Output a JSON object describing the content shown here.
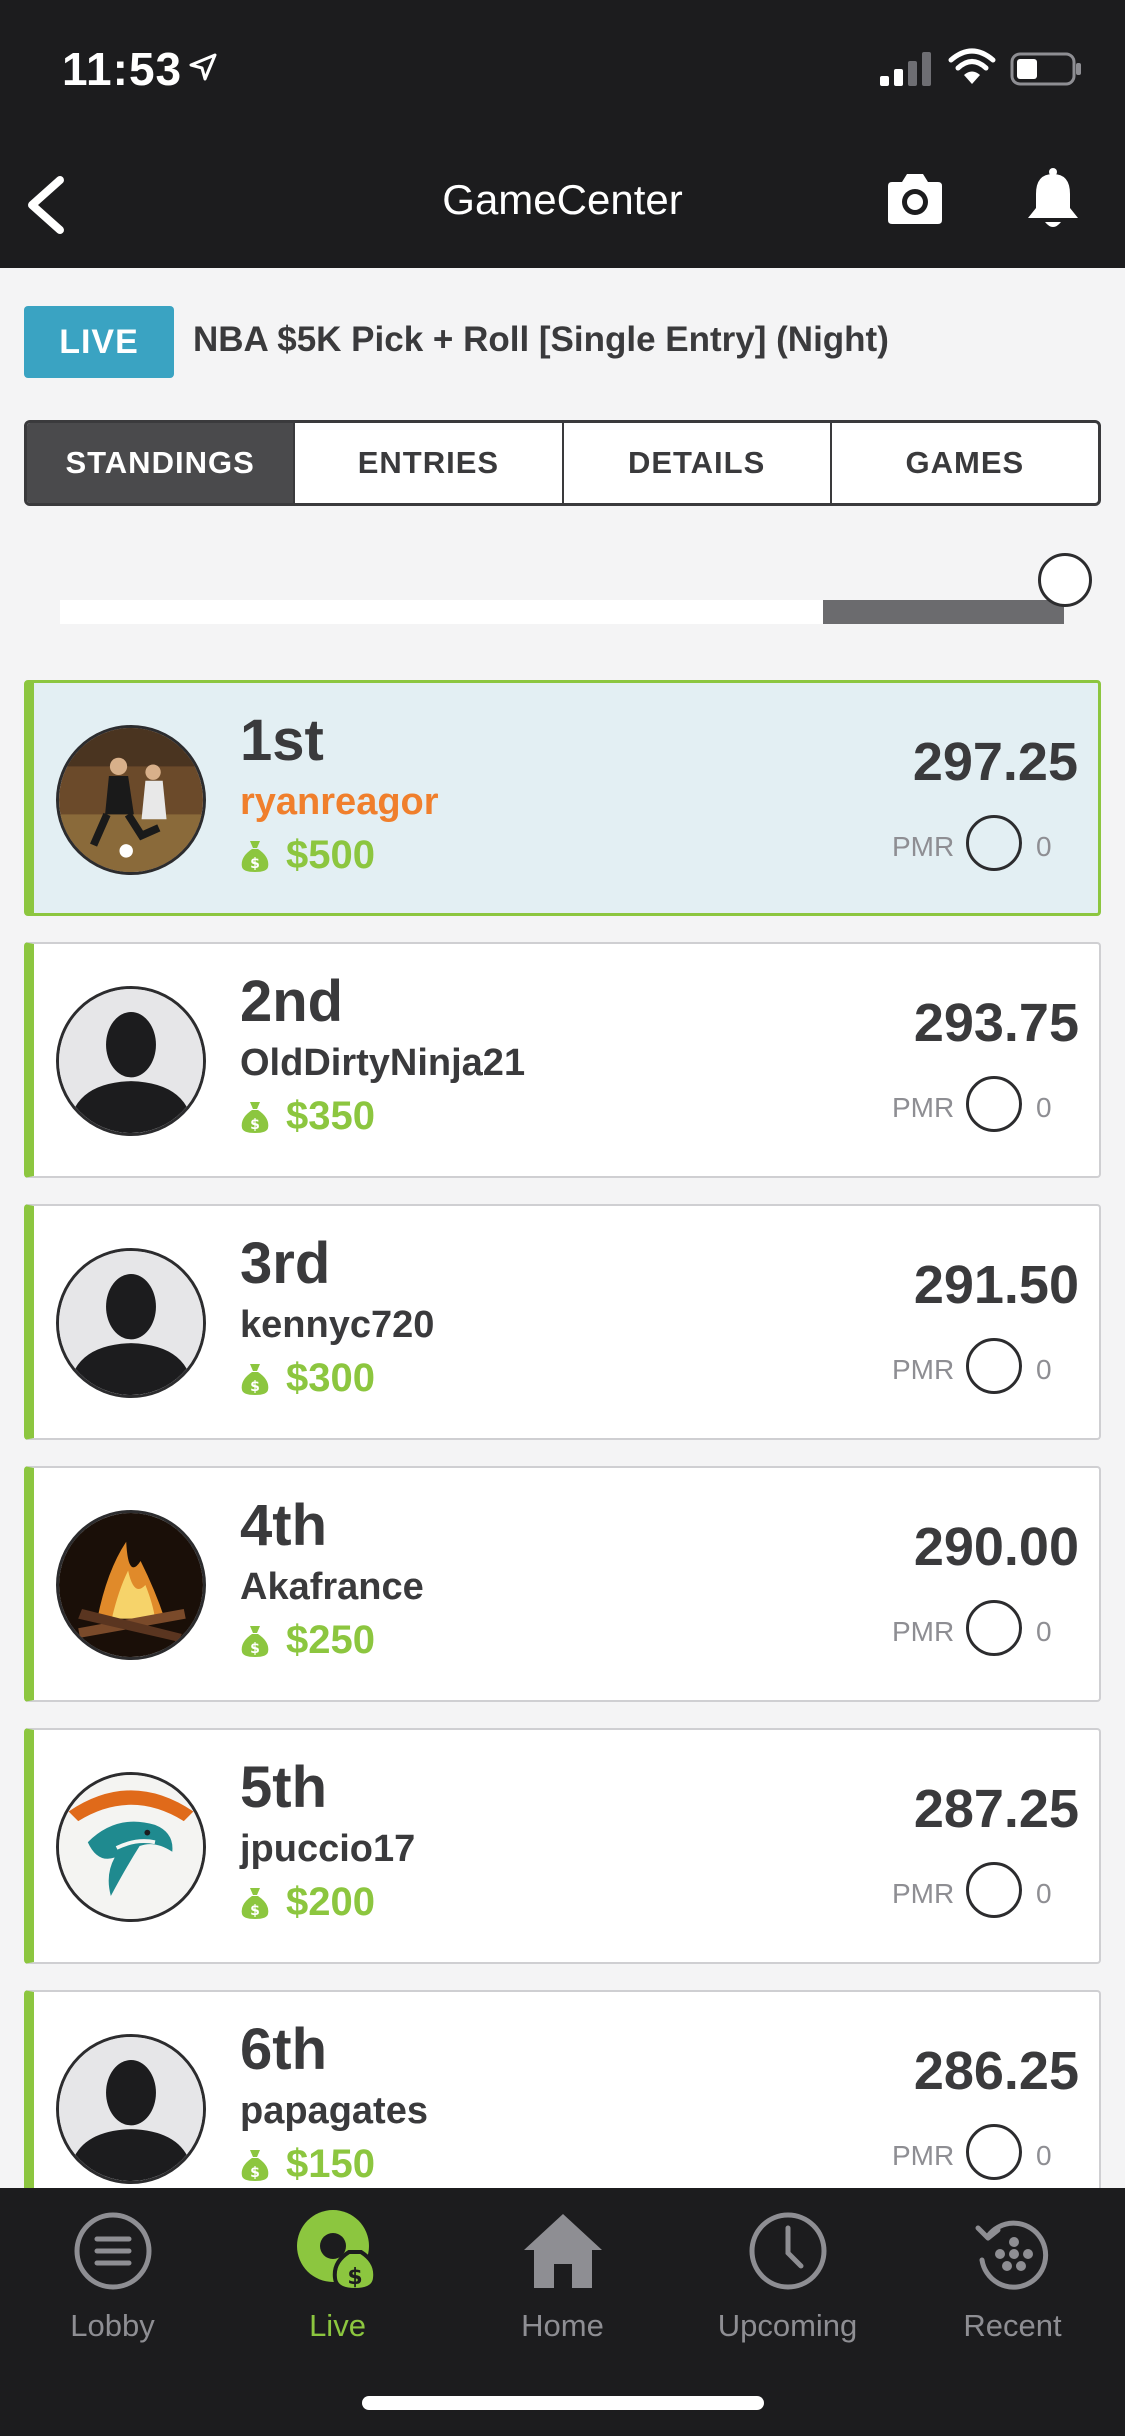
{
  "status_bar": {
    "time": "11:53"
  },
  "navbar": {
    "title": "GameCenter"
  },
  "contest": {
    "badge": "LIVE",
    "title": "NBA $5K Pick + Roll [Single Entry] (Night)"
  },
  "tabs": [
    {
      "label": "STANDINGS",
      "active": true
    },
    {
      "label": "ENTRIES",
      "active": false
    },
    {
      "label": "DETAILS",
      "active": false
    },
    {
      "label": "GAMES",
      "active": false
    }
  ],
  "progress_slider": {
    "value_fraction": 0.76
  },
  "standings": [
    {
      "rank": "1st",
      "username": "ryanreagor",
      "prize": "$500",
      "score": "297.25",
      "pmr_label": "PMR",
      "pmr": "0",
      "avatar": "photo-soccer"
    },
    {
      "rank": "2nd",
      "username": "OldDirtyNinja21",
      "prize": "$350",
      "score": "293.75",
      "pmr_label": "PMR",
      "pmr": "0",
      "avatar": "default-silhouette"
    },
    {
      "rank": "3rd",
      "username": "kennyc720",
      "prize": "$300",
      "score": "291.50",
      "pmr_label": "PMR",
      "pmr": "0",
      "avatar": "default-silhouette"
    },
    {
      "rank": "4th",
      "username": "Akafrance",
      "prize": "$250",
      "score": "290.00",
      "pmr_label": "PMR",
      "pmr": "0",
      "avatar": "photo-campfire"
    },
    {
      "rank": "5th",
      "username": "jpuccio17",
      "prize": "$200",
      "score": "287.25",
      "pmr_label": "PMR",
      "pmr": "0",
      "avatar": "dolphins-logo"
    },
    {
      "rank": "6th",
      "username": "papagates",
      "prize": "$150",
      "score": "286.25",
      "pmr_label": "PMR",
      "pmr": "0",
      "avatar": "default-silhouette"
    }
  ],
  "tabbar": [
    {
      "label": "Lobby",
      "icon": "menu-circle-icon",
      "active": false
    },
    {
      "label": "Live",
      "icon": "live-money-icon",
      "active": true
    },
    {
      "label": "Home",
      "icon": "house-icon",
      "active": false
    },
    {
      "label": "Upcoming",
      "icon": "clock-icon",
      "active": false
    },
    {
      "label": "Recent",
      "icon": "history-icon",
      "active": false
    }
  ],
  "colors": {
    "accent_green": "#8cc63f",
    "live_blue": "#3aa3c2",
    "my_name_orange": "#f07f2c",
    "dark_bar": "#1c1c1e"
  }
}
